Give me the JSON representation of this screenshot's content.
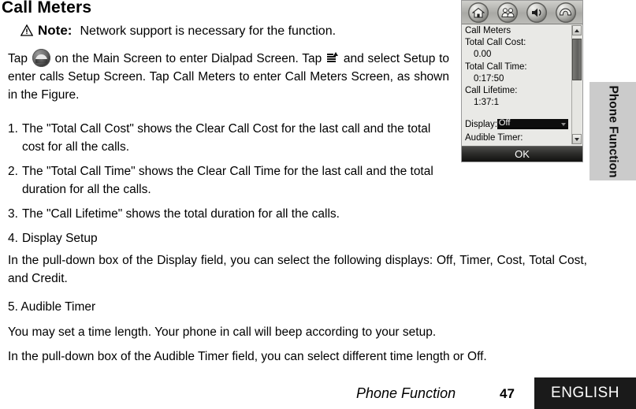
{
  "page": {
    "title": "Call Meters"
  },
  "note": {
    "icon": "warning-triangle-icon",
    "label": "Note:",
    "text": "Network support is necessary for the function."
  },
  "intro": {
    "part1": "Tap",
    "part2": "on the Main Screen to enter Dialpad Screen. Tap",
    "part3": "and select Setup to enter calls Setup Screen. Tap Call Meters to enter Call Meters Screen, as shown in the Figure.",
    "endcall_icon": "end-call-icon",
    "setup_icon": "setup-menu-icon"
  },
  "steps": [
    {
      "num": "1.",
      "text": "The \"Total Call Cost\" shows the Clear Call Cost for the last call and the total cost for all the calls."
    },
    {
      "num": "2.",
      "text": "The \"Total Call Time\" shows the Clear Call Time for the last call and the total duration for all the calls."
    },
    {
      "num": "3.",
      "text": "The \"Call Lifetime\" shows the total duration for all the calls."
    },
    {
      "num": "4.",
      "text": "Display Setup"
    }
  ],
  "body": {
    "display_setup_desc": "In the pull-down box of the Display field, you can select the following displays: Off, Timer, Cost, Total Cost, and Credit.",
    "audible_timer_heading": "5. Audible Timer",
    "audible_timer_desc1": "You may set a time length. Your phone in call will beep according to your setup.",
    "audible_timer_desc2": "In the pull-down box of the Audible Timer field, you can select different time length or Off."
  },
  "device": {
    "toolbar": [
      {
        "name": "home-icon",
        "label": "Home"
      },
      {
        "name": "contacts-icon",
        "label": "Contacts"
      },
      {
        "name": "sound-icon",
        "label": "Sound"
      },
      {
        "name": "end-call-icon",
        "label": "End Call"
      }
    ],
    "screen_title": "Call Meters",
    "fields": [
      {
        "label": "Total Call Cost:",
        "value": "0.00"
      },
      {
        "label": "Total Call Time:",
        "value": "0:17:50"
      },
      {
        "label": "Call Lifetime:",
        "value": "1:37:1"
      }
    ],
    "display_field": {
      "label": "Display:",
      "value": "Off"
    },
    "audible_timer_label": "Audible Timer:",
    "ok_button": "OK",
    "scrollbar": {
      "up_icon": "scroll-up-arrow-icon",
      "down_icon": "scroll-down-arrow-icon"
    }
  },
  "side_tab": {
    "label": "Phone Function"
  },
  "footer": {
    "chapter": "Phone Function",
    "page_number": "47",
    "language": "ENGLISH"
  },
  "colors": {
    "footer_block": "#1a1a1a",
    "side_tab": "#cbcbcb",
    "device_bg": "#e9e9e6",
    "select_bg": "#0d0d0d"
  }
}
